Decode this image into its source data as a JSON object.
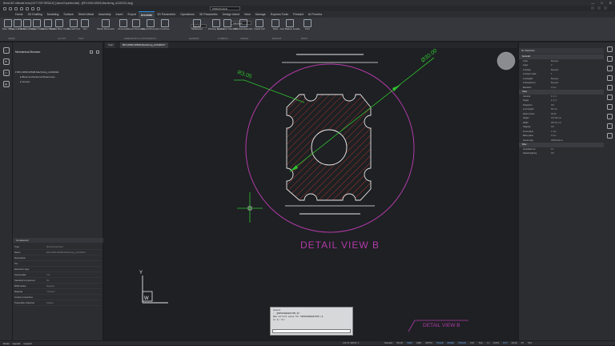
{
  "window": {
    "title": "BricsCAD Ultimate beta (NOT FOR RESALE) [Jamal Expérimental] - [BFV-0050-52508-Machining_ACM2021.dwg]",
    "controls": [
      "—",
      "□",
      "✕"
    ]
  },
  "qat": {
    "workspace": "2DMechanical"
  },
  "menu_tabs": [
    "Home",
    "2D Drafting",
    "Modeling",
    "Surface",
    "Sheet Metal",
    "Assembly",
    "Insert",
    "Export",
    "Annotate",
    "2D Parametric",
    "Operations",
    "3D Parametric",
    "Design Intent",
    "View",
    "Manage",
    "Express Tools",
    "Presskit",
    "AI Preview"
  ],
  "active_tab": "Annotate",
  "ribbon": {
    "buttons": [
      {
        "label": "Save Views"
      },
      {
        "label": "Projected Views"
      },
      {
        "label": "Full Section View"
      },
      {
        "label": "Viewport Detail"
      },
      {
        "label": "Parallel Views"
      },
      {
        "label": "Parallel Base Views"
      },
      {
        "label": "Ray Edit Text"
      },
      {
        "label": "Text"
      },
      {
        "label": "Planar Dimension"
      },
      {
        "label": "Dimension"
      },
      {
        "label": "Linear Dimension"
      },
      {
        "label": "Aligned Dimension"
      },
      {
        "label": "Continue"
      },
      {
        "label": "Multileader"
      },
      {
        "label": "Welding Symbol"
      },
      {
        "label": "Geometric Tolerance"
      },
      {
        "label": "BIM Edit Materials"
      },
      {
        "label": "Fields Cell"
      },
      {
        "label": "Table"
      },
      {
        "label": "Auto Balloon Enable"
      },
      {
        "label": "Print"
      }
    ],
    "style_dropdown": "Standard",
    "iso_dropdown": "ISO-25",
    "groups": [
      "VIEWS",
      "LAYOUT",
      "TEXT",
      "DIMENSIONS & CONSTRAINTS",
      "LEADERS",
      "SYMBOLS",
      "TABLES",
      "MARKUP",
      "PRINT"
    ]
  },
  "left_tools": [
    "⌂",
    "❖",
    "ƒx",
    "▤"
  ],
  "mech_browser": {
    "title": "Mechanical Browser",
    "tree": [
      "BFV-0050-52508-Machining_ACM2021",
      "Block and External References",
      "Groups"
    ]
  },
  "component_panel": {
    "title": "Component",
    "rows": [
      {
        "k": "Type",
        "v": "Mechanical.Root"
      },
      {
        "k": "Name",
        "v": "BFV-0050-52508-Machining_ACM2021"
      },
      {
        "k": "Description",
        "v": ""
      },
      {
        "k": "Pro",
        "v": ""
      },
      {
        "k": "Extension type",
        "v": ""
      },
      {
        "k": "Sectionable",
        "v": "Yes"
      },
      {
        "k": "Standard component",
        "v": "No"
      },
      {
        "k": "BOM status",
        "v": "Regular"
      },
      {
        "k": "Material",
        "v": "<Inherit>"
      },
      {
        "k": "Custom properties",
        "v": ""
      },
      {
        "k": "Preferable character",
        "v": "Indices"
      }
    ]
  },
  "doc_tabs": [
    "Start",
    "BFV-0050-52508-Machining_ACM2021*"
  ],
  "drawing": {
    "dim_radius": "R3.05",
    "dim_diameter": "Ø30.00",
    "detail_label": "DETAIL VIEW B",
    "detail_label_small": "DETAIL VIEW B",
    "ucs_y": "Y",
    "ucs_w": "W",
    "colors": {
      "magenta": "#b23aa8",
      "green": "#2fc22f",
      "red": "#c0392b",
      "white": "#e8e8e8"
    }
  },
  "command_window": {
    "lines": [
      "Cancel",
      ": _QNPSAVEBCEDITOR_S3",
      "New current value for SHPSAVEBCEDITOR (0",
      "to 2) <1>: "
    ],
    "input": ":"
  },
  "properties": {
    "selection": "No Selection",
    "sections": [
      {
        "name": "General",
        "rows": [
          {
            "k": "Color",
            "v": "ByLayer"
          },
          {
            "k": "Layer",
            "v": "0"
          },
          {
            "k": "Linetype",
            "v": "ByLayer"
          },
          {
            "k": "Linetype scale",
            "v": "1"
          },
          {
            "k": "Lineweight",
            "v": "ByLayer"
          },
          {
            "k": "Transparency",
            "v": "ByLayer"
          },
          {
            "k": "Elevation",
            "v": "0 mm"
          }
        ]
      },
      {
        "name": "View",
        "rows": [
          {
            "k": "Camera",
            "v": "0, 0, 1"
          },
          {
            "k": "Target",
            "v": "0, 0, 0"
          },
          {
            "k": "Projection",
            "v": "Off"
          },
          {
            "k": "Lens length",
            "v": "50 mm"
          },
          {
            "k": "Field of view",
            "v": "40.00"
          },
          {
            "k": "Height",
            "v": "147.26 mm"
          },
          {
            "k": "Width",
            "v": "257.16 mm"
          },
          {
            "k": "Clipping",
            "v": "Off"
          },
          {
            "k": "Front plane",
            "v": "1 mm"
          },
          {
            "k": "Back plane",
            "v": "0 mm"
          },
          {
            "k": "Visual style",
            "v": "2dWireframe"
          }
        ]
      },
      {
        "name": "Misc",
        "rows": [
          {
            "k": "Annotation sc",
            "v": "1:1"
          },
          {
            "k": "Default lighting",
            "v": "Off"
          }
        ]
      }
    ]
  },
  "status": {
    "layouts": [
      "Model",
      "Layout1",
      "Layout2"
    ],
    "coords": "210.79, 966.81, 0",
    "toggles": [
      "Standard",
      "ISO-25",
      "SNAP",
      "GRID",
      "ORTHO",
      "POLAR",
      "ESNAP",
      "STRACK",
      "LWT",
      "TILE",
      "1:1",
      "DUCS",
      "DYN",
      "QUAD",
      "RT",
      "HKA",
      "LOCKUI",
      "None",
      "Mechanical",
      "PUBLISH"
    ],
    "on": [
      "SNAP",
      "POLAR",
      "ESNAP",
      "STRACK",
      "DYN"
    ]
  }
}
